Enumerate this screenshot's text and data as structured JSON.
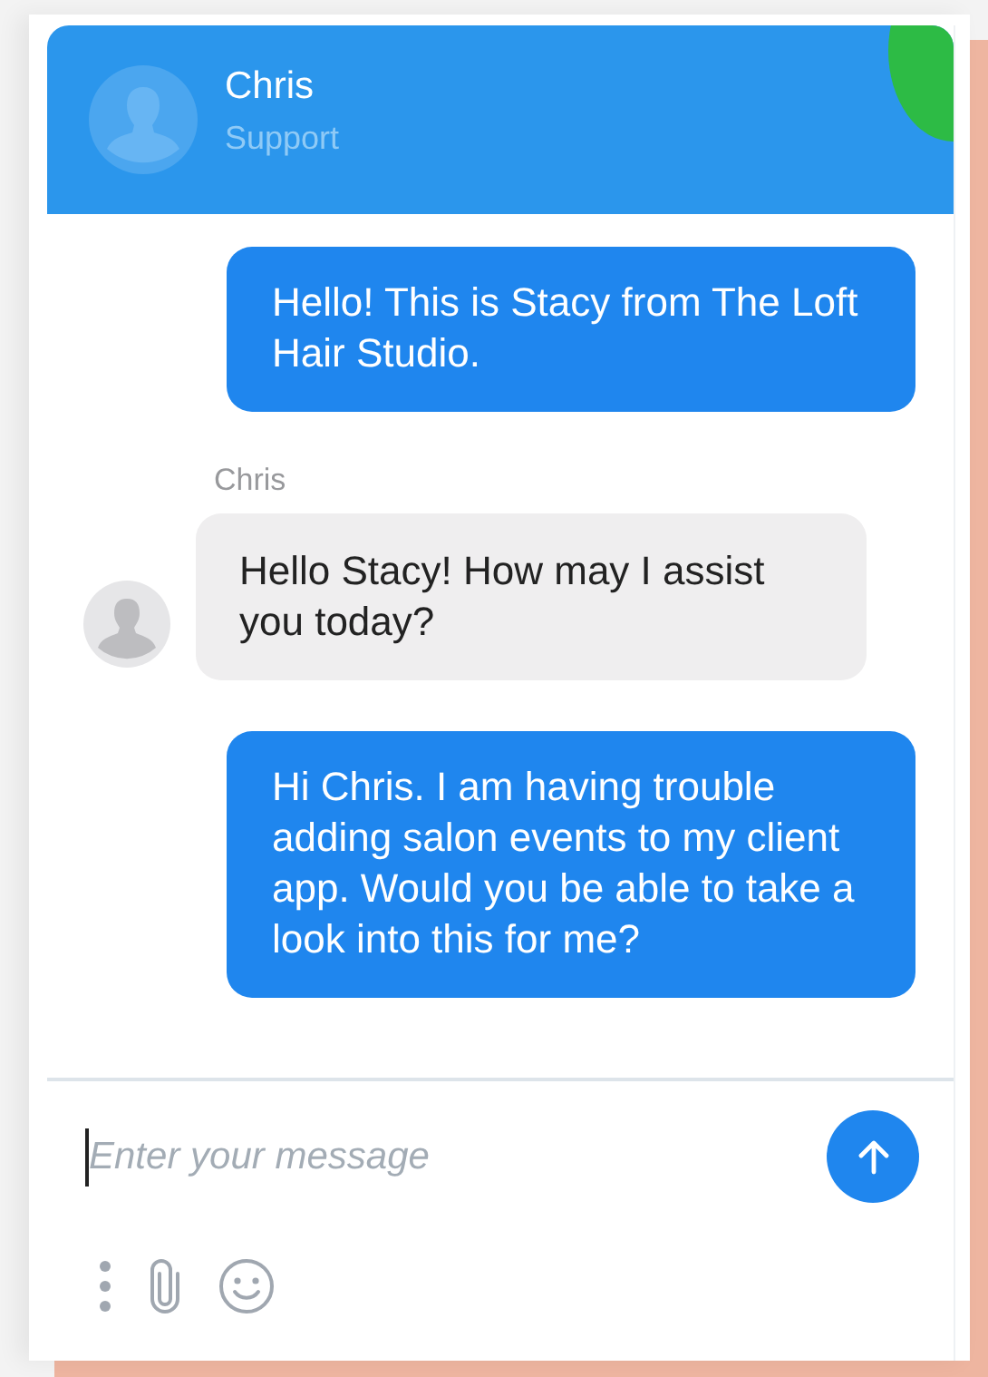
{
  "header": {
    "name": "Chris",
    "role": "Support"
  },
  "messages": [
    {
      "kind": "sent",
      "text": "Hello! This is Stacy from The Loft Hair Studio."
    },
    {
      "kind": "received",
      "sender": "Chris",
      "text": "Hello Stacy! How may I assist you today?"
    },
    {
      "kind": "sent",
      "text": "Hi Chris. I am having trouble adding salon events to my client app. Would you be able to take a look into this for me?"
    }
  ],
  "composer": {
    "placeholder": "Enter your message"
  }
}
